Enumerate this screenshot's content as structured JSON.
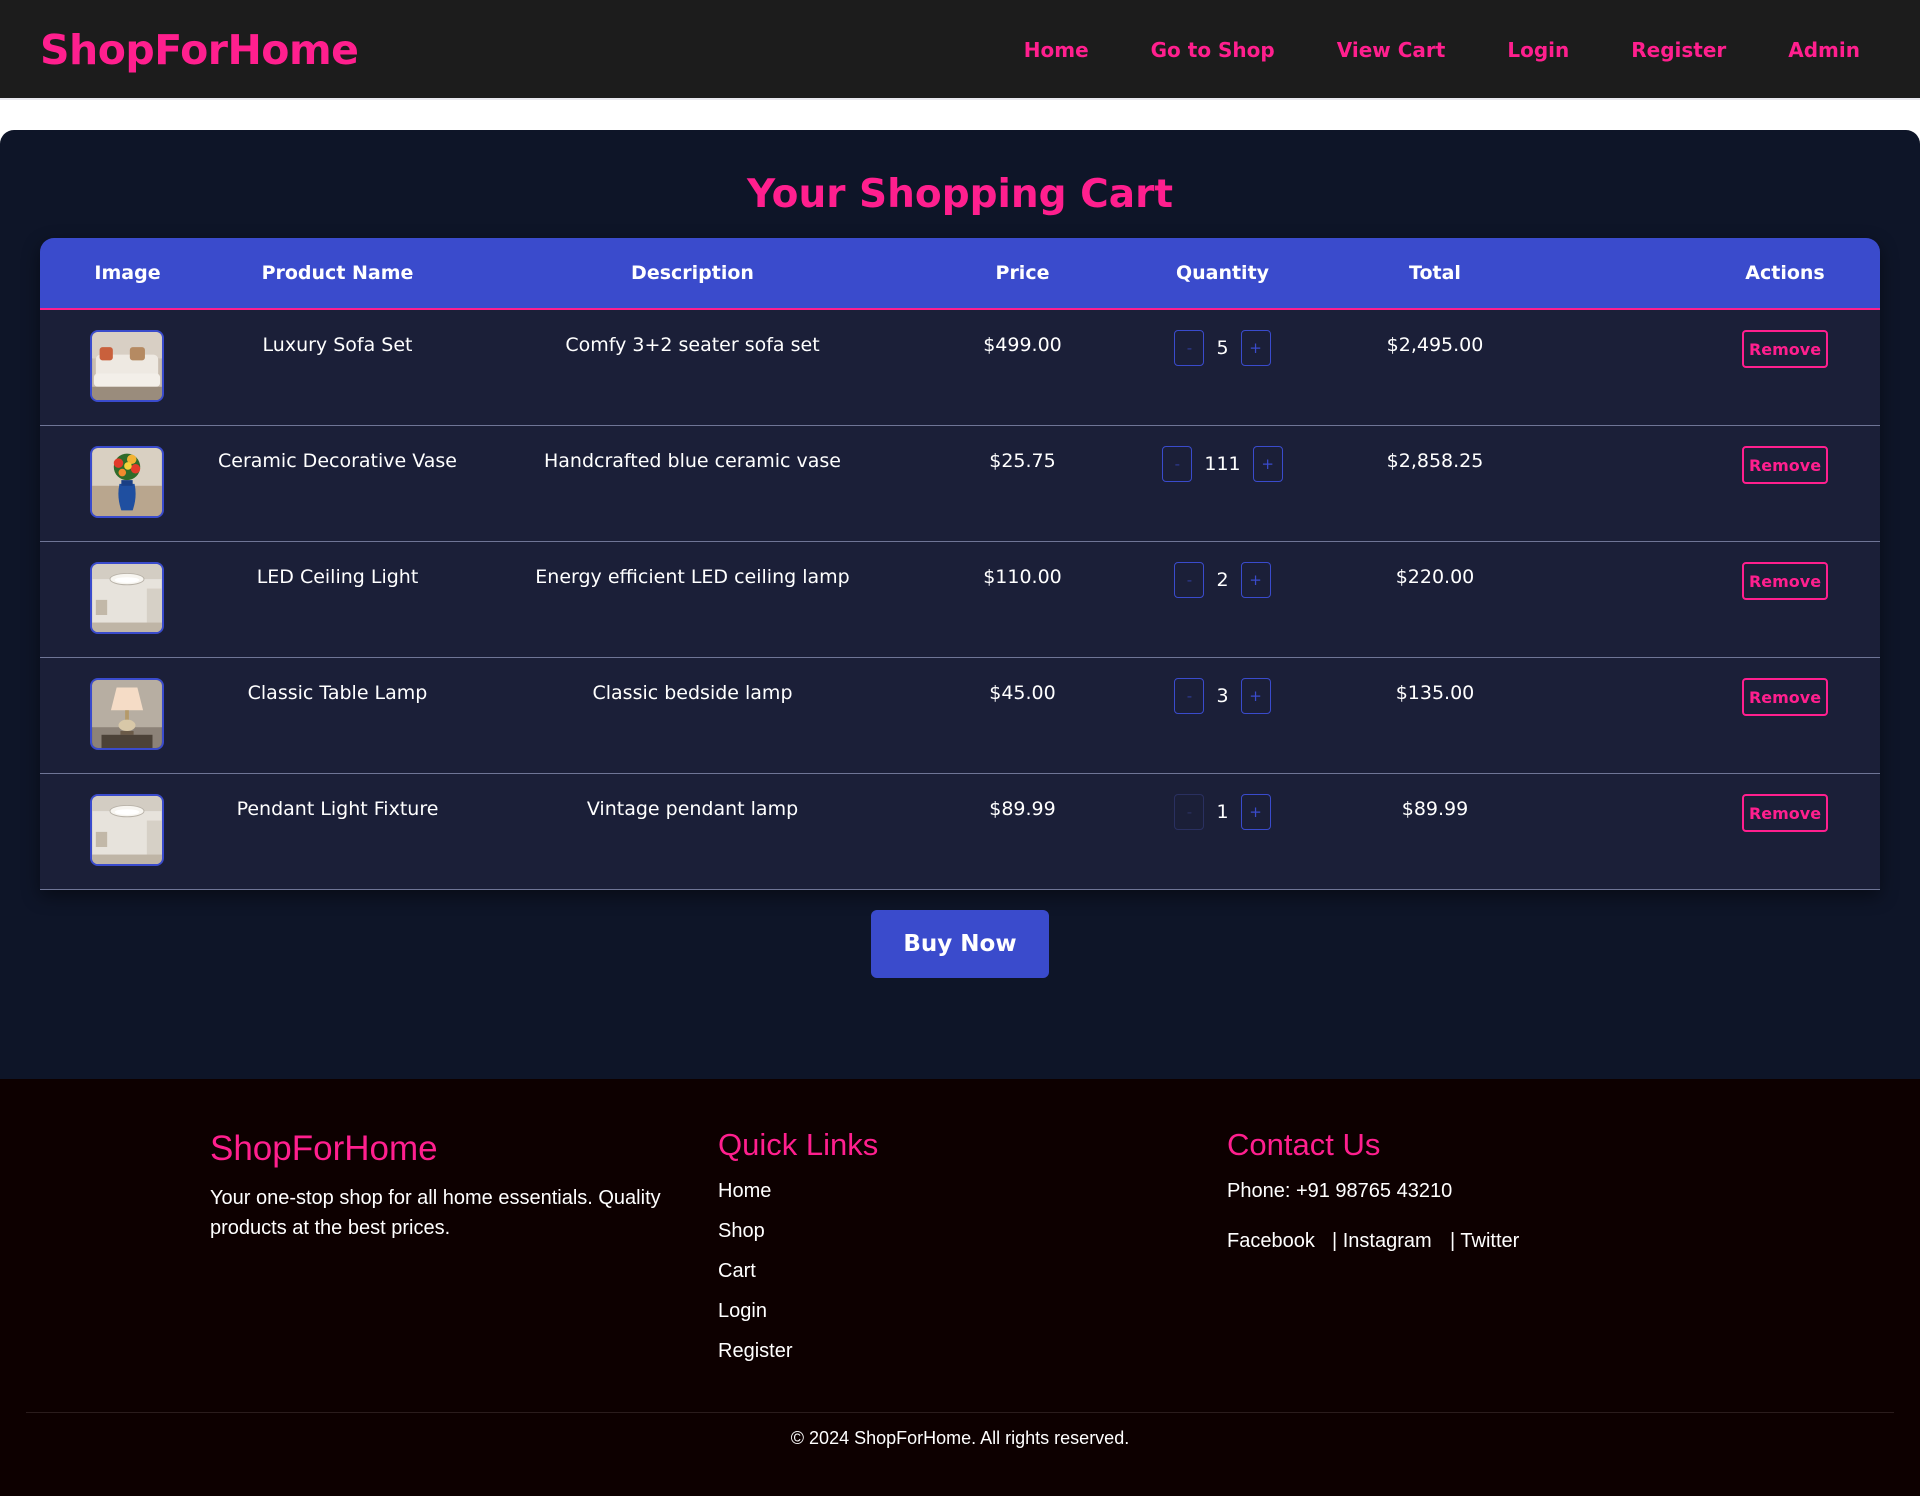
{
  "header": {
    "brand": "ShopForHome",
    "nav": [
      "Home",
      "Go to Shop",
      "View Cart",
      "Login",
      "Register",
      "Admin"
    ]
  },
  "cart": {
    "title": "Your Shopping Cart",
    "columns": [
      "Image",
      "Product Name",
      "Description",
      "Price",
      "Quantity",
      "Total",
      "Actions"
    ],
    "rows": [
      {
        "name": "Luxury Sofa Set",
        "description": "Comfy 3+2 seater sofa set",
        "price": "$499.00",
        "quantity": "5",
        "total": "$2,495.00",
        "action": "Remove",
        "image": "sofa-image"
      },
      {
        "name": "Ceramic Decorative Vase",
        "description": "Handcrafted blue ceramic vase",
        "price": "$25.75",
        "quantity": "111",
        "total": "$2,858.25",
        "action": "Remove",
        "image": "vase-image"
      },
      {
        "name": "LED Ceiling Light",
        "description": "Energy efficient LED ceiling lamp",
        "price": "$110.00",
        "quantity": "2",
        "total": "$220.00",
        "action": "Remove",
        "image": "ceiling-light-image"
      },
      {
        "name": "Classic Table Lamp",
        "description": "Classic bedside lamp",
        "price": "$45.00",
        "quantity": "3",
        "total": "$135.00",
        "action": "Remove",
        "image": "table-lamp-image"
      },
      {
        "name": "Pendant Light Fixture",
        "description": "Vintage pendant lamp",
        "price": "$89.99",
        "quantity": "1",
        "total": "$89.99",
        "action": "Remove",
        "image": "pendant-light-image"
      }
    ],
    "minus_label": "-",
    "plus_label": "+",
    "buy_label": "Buy Now"
  },
  "footer": {
    "brand": "ShopForHome",
    "tagline": "Your one-stop shop for all home essentials. Quality products at the best prices.",
    "quick_links_title": "Quick Links",
    "quick_links": [
      "Home",
      "Shop",
      "Cart",
      "Login",
      "Register"
    ],
    "contact_title": "Contact Us",
    "phone": "Phone: +91 98765 43210",
    "social": [
      "Facebook",
      "| Instagram",
      "| Twitter"
    ],
    "copyright": "© 2024 ShopForHome. All rights reserved."
  },
  "colors": {
    "accent": "#ff1f8e",
    "primary": "#3a4bcc",
    "header_bg": "#1c1c1c",
    "panel_bg": "#0e1528",
    "row_bg": "#1b1f38",
    "footer_bg": "#0d0000"
  }
}
